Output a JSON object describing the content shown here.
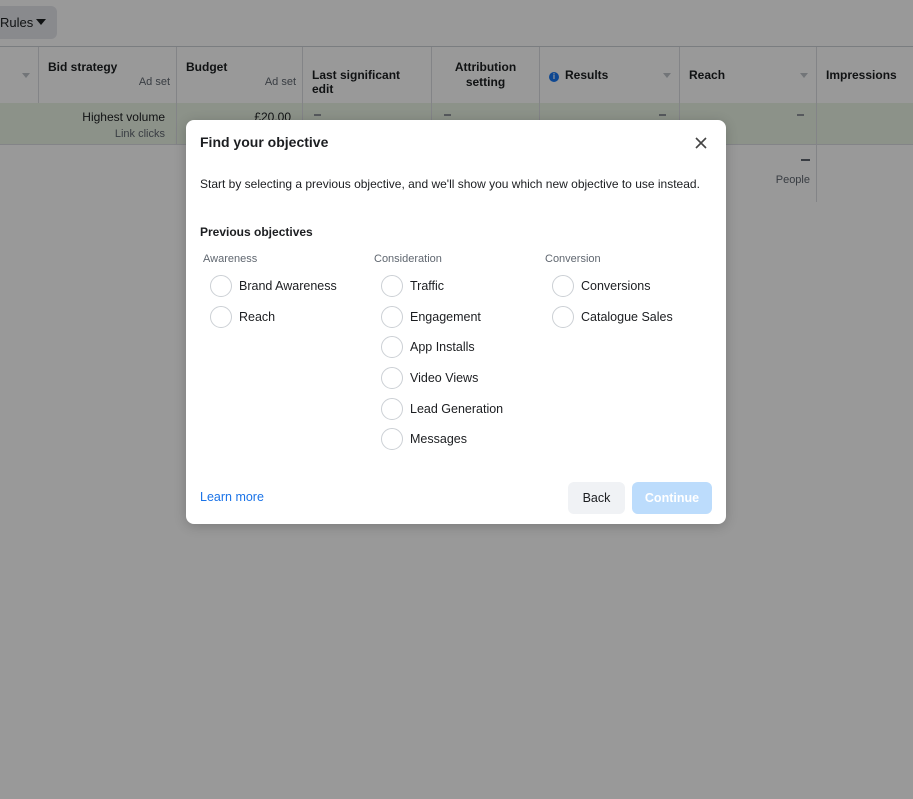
{
  "toolbar": {
    "rules_label": "Rules"
  },
  "table": {
    "headers": [
      {
        "label": "Bid strategy",
        "sub": "Ad set"
      },
      {
        "label": "Budget",
        "sub": "Ad set"
      },
      {
        "label": "Last significant edit"
      },
      {
        "label": "Attribution setting"
      },
      {
        "label": "Results"
      },
      {
        "label": "Reach"
      },
      {
        "label": "Impressions"
      }
    ],
    "row": {
      "bid_strategy": "Highest volume",
      "bid_sub": "Link clicks",
      "budget": "£20.00"
    },
    "summary": {
      "reach_unit": "People"
    }
  },
  "modal": {
    "title": "Find your objective",
    "description": "Start by selecting a previous objective, and we'll show you which new objective to use instead.",
    "section_label": "Previous objectives",
    "groups": [
      {
        "label": "Awareness",
        "options": [
          "Brand Awareness",
          "Reach"
        ]
      },
      {
        "label": "Consideration",
        "options": [
          "Traffic",
          "Engagement",
          "App Installs",
          "Video Views",
          "Lead Generation",
          "Messages"
        ]
      },
      {
        "label": "Conversion",
        "options": [
          "Conversions",
          "Catalogue Sales"
        ]
      }
    ],
    "learn_more": "Learn more",
    "back": "Back",
    "continue": "Continue"
  },
  "colors": {
    "accent": "#1a73e8",
    "continue_disabled": "#bcdcfc",
    "selected_row": "#eaf3e4"
  }
}
